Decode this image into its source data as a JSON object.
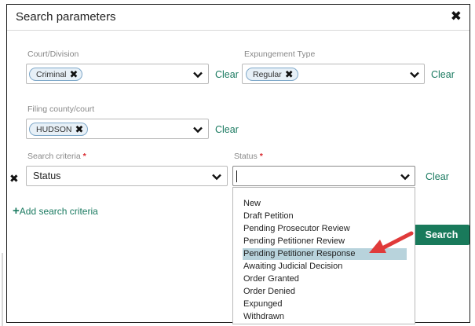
{
  "dialog": {
    "title": "Search parameters",
    "close_glyph": "✖"
  },
  "court_division": {
    "label": "Court/Division",
    "chip": "Criminal",
    "clear": "Clear"
  },
  "expungement_type": {
    "label": "Expungement Type",
    "chip": "Regular",
    "clear": "Clear"
  },
  "filing_county": {
    "label": "Filing county/court",
    "chip": "HUDSON",
    "clear": "Clear"
  },
  "search_criteria": {
    "label": "Search criteria",
    "required_mark": "*",
    "value": "Status",
    "remove_glyph": "✖"
  },
  "status": {
    "label": "Status",
    "required_mark": "*",
    "value": "",
    "clear": "Clear",
    "options": [
      "New",
      "Draft Petition",
      "Pending Prosecutor Review",
      "Pending Petitioner Review",
      "Pending Petitioner Response",
      "Awaiting Judicial Decision",
      "Order Granted",
      "Order Denied",
      "Expunged",
      "Withdrawn"
    ],
    "highlighted_option": "Pending Petitioner Response"
  },
  "add_criteria": {
    "plus": "+",
    "label": "Add search criteria"
  },
  "search_button": "Search",
  "colors": {
    "accent_green": "#197a5b",
    "link_green": "#1a7a60",
    "chip_bg": "#e7f0f7",
    "highlight": "#b8d3dc",
    "required_red": "#d9262c",
    "annotation_arrow": "#e03a3a"
  },
  "icons": {
    "close": "close-icon",
    "chip_remove": "remove-chip-icon",
    "dropdown": "chevron-down-icon"
  }
}
